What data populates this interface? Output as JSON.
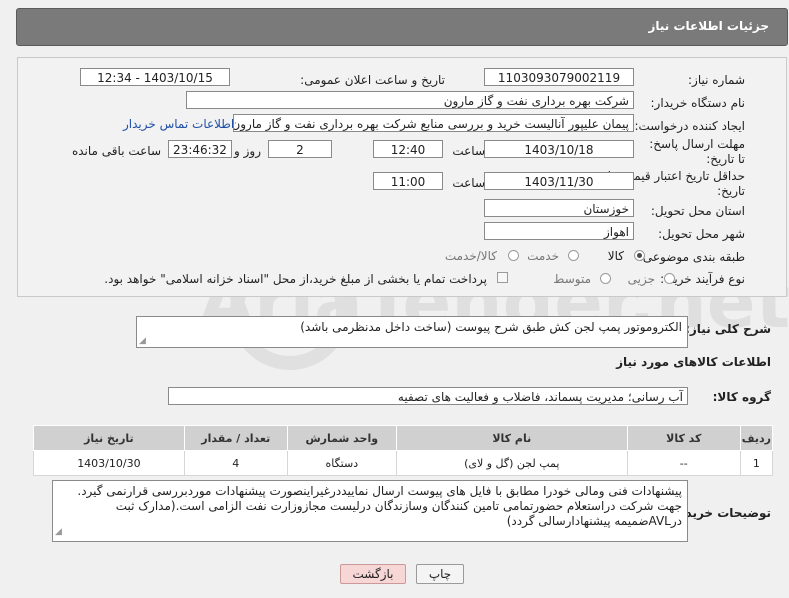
{
  "header": {
    "title": "جزئیات اطلاعات نیاز"
  },
  "form": {
    "need_number": {
      "label": "شماره نیاز:",
      "value": "1103093079002119"
    },
    "announce": {
      "label": "تاریخ و ساعت اعلان عمومی:",
      "value": "1403/10/15 - 12:34"
    },
    "buyer_org": {
      "label": "نام دستگاه خریدار:",
      "value": "شرکت بهره برداری نفت و گاز مارون"
    },
    "requester": {
      "label": "ایجاد کننده درخواست:",
      "value": "پیمان علیپور آنالیست خرید و بررسی منابع شرکت بهره برداری نفت و گاز مارون",
      "contact_link": "اطلاعات تماس خریدار"
    },
    "reply_deadline": {
      "label": "مهلت ارسال پاسخ: تا تاریخ:",
      "date": "1403/10/18",
      "time_label": "ساعت",
      "time": "12:40",
      "days": "2",
      "days_label": "روز و",
      "remaining": "23:46:32",
      "remaining_label": "ساعت باقی مانده"
    },
    "price_validity": {
      "label": "حداقل تاریخ اعتبار قیمت: تا تاریخ:",
      "date": "1403/11/30",
      "time_label": "ساعت",
      "time": "11:00"
    },
    "province": {
      "label": "استان محل تحویل:",
      "value": "خوزستان"
    },
    "city": {
      "label": "شهر محل تحویل:",
      "value": "اهواز"
    },
    "category": {
      "label": "طبقه بندی موضوعی:",
      "options": [
        "کالا",
        "خدمت",
        "کالا/خدمت"
      ],
      "selected": "کالا"
    },
    "purchase_type": {
      "label": "نوع فرآیند خرید :",
      "options": [
        "جزیی",
        "متوسط"
      ],
      "note": "پرداخت تمام یا بخشی از مبلغ خرید،از محل \"اسناد خزانه اسلامی\" خواهد بود."
    }
  },
  "description": {
    "label": "شرح کلی نیاز:",
    "value": "الکتروموتور پمپ لجن کش طبق شرح پیوست (ساخت داخل مدنظرمی باشد)"
  },
  "goods_section_title": "اطلاعات کالاهای مورد نیاز",
  "goods_group": {
    "label": "گروه کالا:",
    "value": "آب رسانی؛ مدیریت پسماند، فاضلاب و فعالیت های تصفیه"
  },
  "table": {
    "headers": [
      "ردیف",
      "کد کالا",
      "نام کالا",
      "واحد شمارش",
      "تعداد / مقدار",
      "تاریخ نیاز"
    ],
    "rows": [
      [
        "1",
        "--",
        "پمپ لجن (گل و لای)",
        "دستگاه",
        "4",
        "1403/10/30"
      ]
    ]
  },
  "buyer_notes": {
    "label": "توضیحات خریدار:",
    "lines": [
      "پیشنهادات فنی ومالی خودرا  مطابق با فایل های پیوست ارسال نماییددرغیراینصورت پیشنهادات موردبررسی قرارنمی گیرد.",
      "جهت شرکت دراستعلام حضورتمامی تامین کنندگان وسازندگان درلیست مجازوزارت نفت الزامی است.(مدارک ثبت",
      "درAVLضمیمه پیشنهادارسالی گردد)"
    ]
  },
  "buttons": {
    "print": "چاپ",
    "back": "بازگشت"
  },
  "watermark": "AriaTender.net"
}
